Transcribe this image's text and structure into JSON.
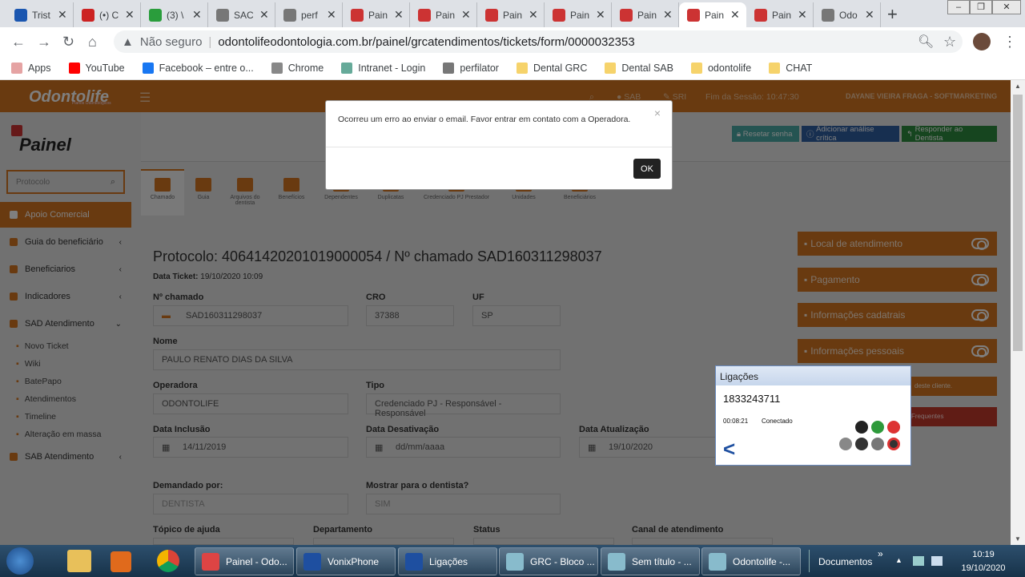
{
  "browser": {
    "tabs": [
      {
        "label": "Trist",
        "color": "#1a56b0"
      },
      {
        "label": "(•) C",
        "color": "#c22"
      },
      {
        "label": "(3) \\",
        "color": "#2a9d3c"
      },
      {
        "label": "SAC",
        "color": "#777"
      },
      {
        "label": "perf",
        "color": "#777"
      },
      {
        "label": "Pain",
        "color": "#c33"
      },
      {
        "label": "Pain",
        "color": "#c33"
      },
      {
        "label": "Pain",
        "color": "#c33"
      },
      {
        "label": "Pain",
        "color": "#c33"
      },
      {
        "label": "Pain",
        "color": "#c33"
      },
      {
        "label": "Pain",
        "color": "#c33"
      },
      {
        "label": "Pain",
        "color": "#c33"
      },
      {
        "label": "Odo",
        "color": "#777"
      }
    ],
    "address": {
      "security": "Não seguro",
      "url": "odontolifeodontologia.com.br/painel/grcatendimentos/tickets/form/0000032353"
    },
    "bookmarks": [
      "Apps",
      "YouTube",
      "Facebook – entre o...",
      "Chrome",
      "Intranet - Login",
      "perfilator",
      "Dental GRC",
      "Dental SAB",
      "odontolife",
      "CHAT"
    ]
  },
  "header": {
    "logo": "Odontolife",
    "logo_sub": "Planos Odontológicos",
    "sab": "SAB",
    "sri": "SRI",
    "session": "Fim da Sessão: 10:47:30",
    "user": "DAYANE VIEIRA FRAGA - SOFTMARKETING"
  },
  "sidebar": {
    "brand": "Painel",
    "search_placeholder": "Protocolo",
    "items": [
      {
        "label": "Apoio Comercial"
      },
      {
        "label": "Guia do beneficiário"
      },
      {
        "label": "Beneficiarios"
      },
      {
        "label": "Indicadores"
      },
      {
        "label": "SAD Atendimento"
      },
      {
        "label": "SAB Atendimento"
      }
    ],
    "subitems": [
      "Novo Ticket",
      "Wiki",
      "BatePapo",
      "Atendimentos",
      "Timeline",
      "Alteração em massa"
    ]
  },
  "actions": {
    "reset": "Resetar senha",
    "analysis": "Adicionar análise crítica",
    "reply": "Responder ao Dentista"
  },
  "toolbar_tabs": [
    "Chamado",
    "Guia",
    "Arquivos do dentista",
    "Benefícios",
    "Dependentes",
    "Duplicatas",
    "Credenciado PJ Prestador",
    "Unidades",
    "Beneficiários"
  ],
  "ticket": {
    "title": "Protocolo: 40641420201019000054 / Nº chamado SAD160311298037",
    "date_label": "Data Ticket:",
    "date_value": "19/10/2020 10:09",
    "fields": {
      "chamado_label": "Nº chamado",
      "chamado": "SAD160311298037",
      "cro_label": "CRO",
      "cro": "37388",
      "uf_label": "UF",
      "uf": "SP",
      "nome_label": "Nome",
      "nome": "PAULO RENATO DIAS DA SILVA",
      "operadora_label": "Operadora",
      "operadora": "ODONTOLIFE",
      "tipo_label": "Tipo",
      "tipo": "Credenciado PJ - Responsável  - Responsável",
      "inclusao_label": "Data Inclusão",
      "inclusao": "14/11/2019",
      "desativacao_label": "Data Desativação",
      "desativacao": "dd/mm/aaaa",
      "atualizacao_label": "Data Atualização",
      "atualizacao": "19/10/2020",
      "demandado_label": "Demandado por:",
      "demandado": "DENTISTA",
      "mostrar_label": "Mostrar para o dentista?",
      "mostrar": "SIM",
      "topico_label": "Tópico de ajuda",
      "departamento_label": "Departamento",
      "status_label": "Status",
      "canal_label": "Canal de atendimento"
    }
  },
  "panels": [
    "Local de atendimento",
    "Pagamento",
    "Informações cadatrais",
    "Informações pessoais"
  ],
  "panel_notes": {
    "cliente": "deste cliente.",
    "frequentes": "Frequentes"
  },
  "modal": {
    "message": "Ocorreu um erro ao enviar o email. Favor entrar em contato com a Operadora.",
    "ok": "OK",
    "close": "×"
  },
  "phone": {
    "title": "Ligações",
    "number": "1833243711",
    "duration": "00:08:21",
    "status": "Conectado"
  },
  "taskbar": {
    "items": [
      "Painel - Odo...",
      "VonixPhone",
      "Ligações",
      "GRC - Bloco ...",
      "Sem título - ...",
      "Odontolife -..."
    ],
    "documents": "Documentos",
    "time": "10:19",
    "date": "19/10/2020"
  }
}
